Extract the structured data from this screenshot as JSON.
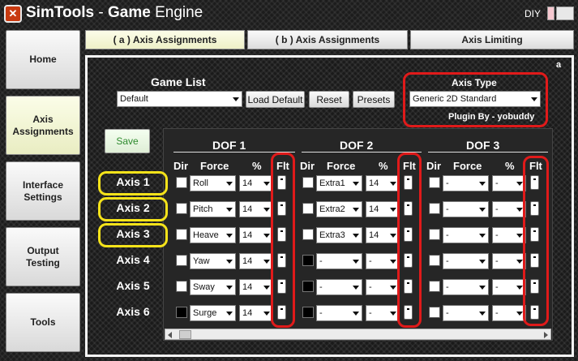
{
  "window": {
    "app_icon": "simtools-logo-icon",
    "title_part1": "SimTools",
    "title_part2": " - ",
    "title_part3": "Game",
    "title_part4": " Engine",
    "diy_label": "DIY"
  },
  "nav": {
    "home": "Home",
    "axis_assignments": "Axis Assignments",
    "interface_settings": "Interface Settings",
    "output_testing": "Output Testing",
    "tools": "Tools"
  },
  "tabs": {
    "a": "( a ) Axis Assignments",
    "b": "( b ) Axis Assignments",
    "limiting": "Axis Limiting"
  },
  "panel": {
    "corner": "a",
    "game_list_label": "Game List",
    "game_list_value": "Default",
    "load_default": "Load Default",
    "reset": "Reset",
    "presets": "Presets",
    "axis_type_label": "Axis Type",
    "axis_type_value": "Generic 2D Standard",
    "plugin_by": "Plugin By - yobuddy",
    "save": "Save"
  },
  "grid": {
    "dof_titles": [
      "DOF 1",
      "DOF 2",
      "DOF 3"
    ],
    "col_dir": "Dir",
    "col_force": "Force",
    "col_pct": "%",
    "col_flt": "Flt",
    "axes": [
      "Axis 1",
      "Axis 2",
      "Axis 3",
      "Axis 4",
      "Axis 5",
      "Axis 6"
    ],
    "dof1_force": [
      "Roll",
      "Pitch",
      "Heave",
      "Yaw",
      "Sway",
      "Surge"
    ],
    "dof1_pct": [
      "14",
      "14",
      "14",
      "14",
      "14",
      "14"
    ],
    "dof2_force": [
      "Extra1",
      "Extra2",
      "Extra3",
      "-",
      "-",
      "-"
    ],
    "dof2_pct": [
      "14",
      "14",
      "14",
      "-",
      "-",
      "-"
    ],
    "dof3_force": [
      "-",
      "-",
      "-",
      "-",
      "-",
      "-"
    ],
    "dof3_pct": [
      "-",
      "-",
      "-",
      "-",
      "-",
      "-"
    ]
  },
  "colors": {
    "highlight_red": "#e01a1a",
    "highlight_yellow": "#f5e31a"
  }
}
